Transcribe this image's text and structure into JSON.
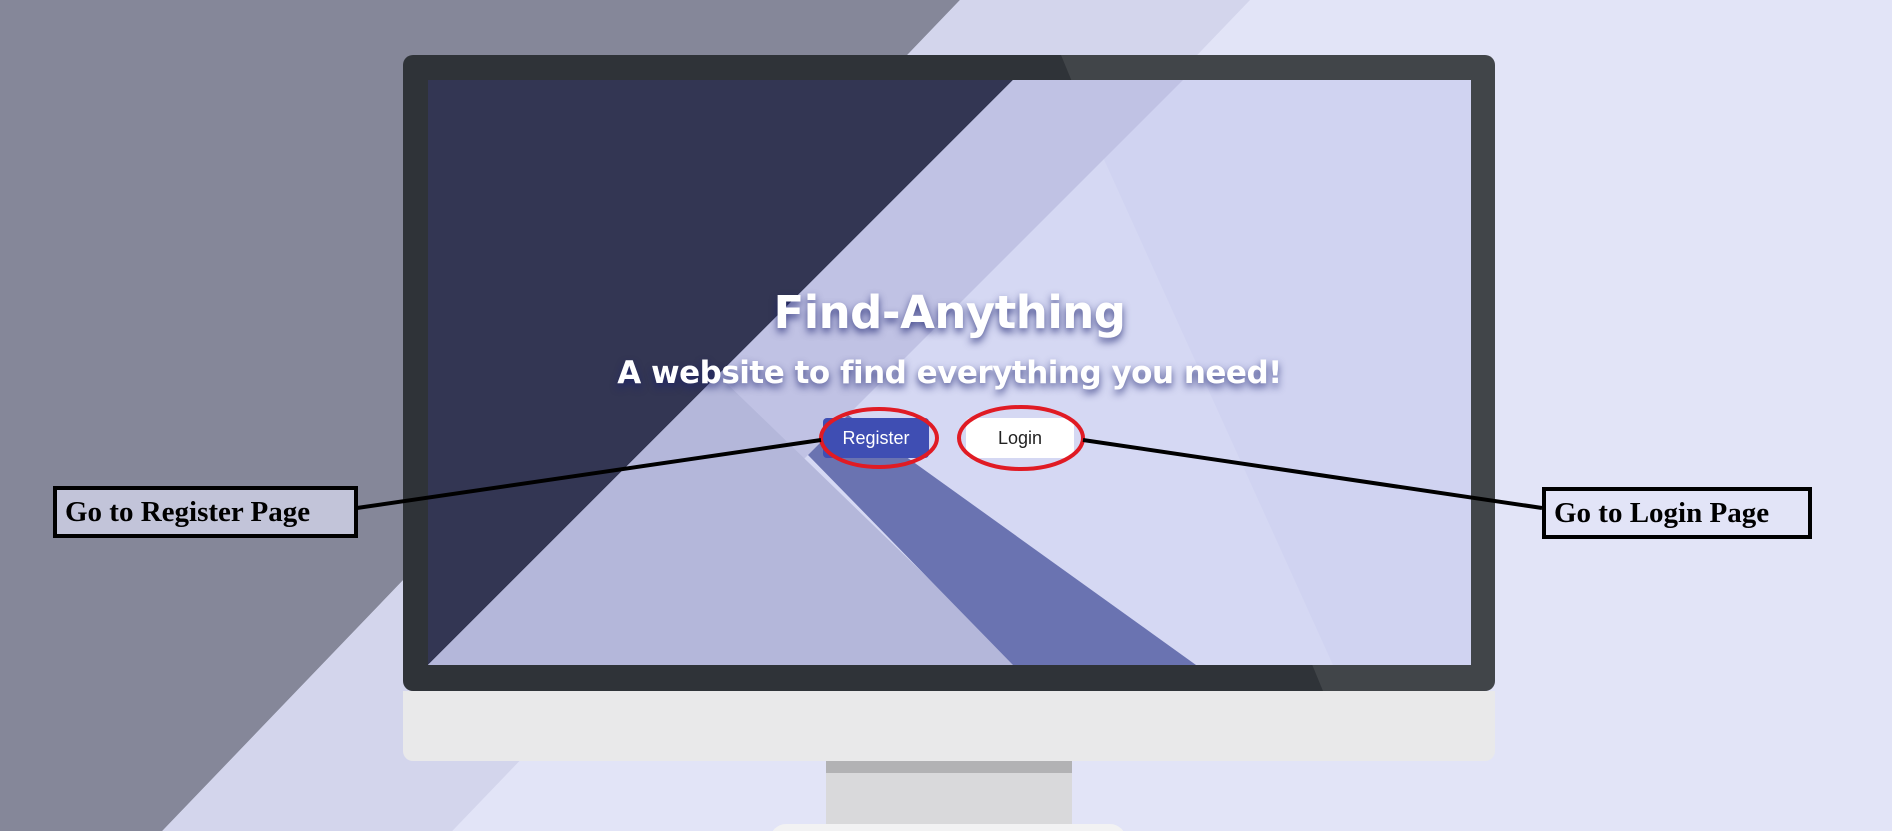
{
  "hero": {
    "title": "Find-Anything",
    "subtitle": "A website to find everything you need!"
  },
  "buttons": {
    "register_label": "Register",
    "login_label": "Login"
  },
  "callouts": {
    "register": "Go to Register Page",
    "login": "Go to Login Page"
  },
  "colors": {
    "register_button": "#3f4eb3",
    "login_button": "#ffffff",
    "screen_dark": "#333653",
    "highlight_ellipse": "#e01b24",
    "page_background": "#e2e4f7"
  }
}
